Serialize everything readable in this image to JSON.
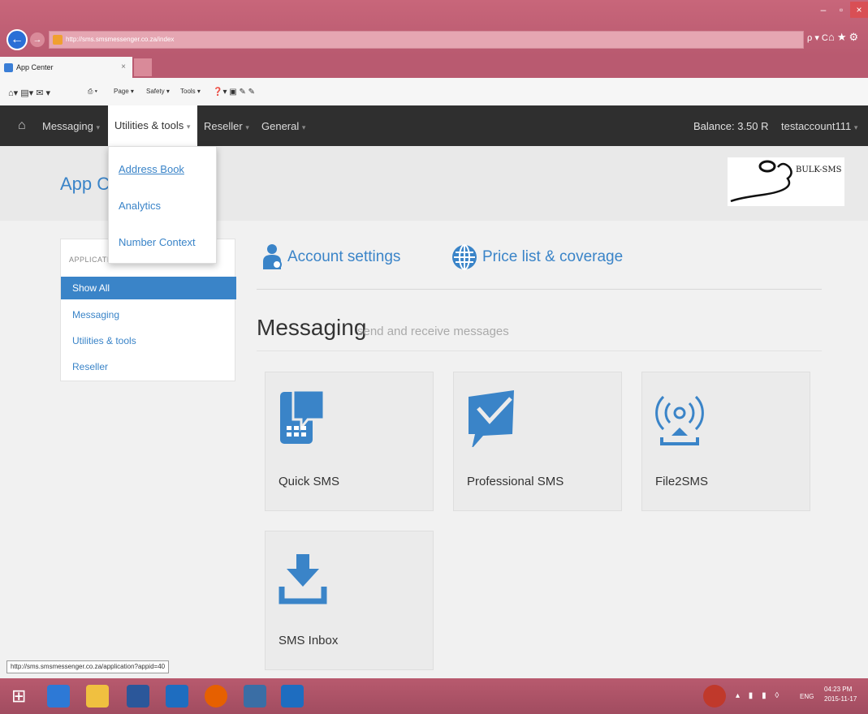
{
  "browser": {
    "url": "http://sms.smsmessenger.co.za/index",
    "tab_title": "App Center",
    "tab_close": "×",
    "addr_tools": "ρ ▾ C",
    "command_bar": {
      "page": "Page ▾",
      "safety": "Safety ▾",
      "tools": "Tools ▾"
    },
    "status_url": "http://sms.smsmessenger.co.za/application?appid=40"
  },
  "navbar": {
    "items": [
      {
        "label": "Messaging"
      },
      {
        "label": "Utilities & tools"
      },
      {
        "label": "Reseller"
      },
      {
        "label": "General"
      }
    ],
    "balance": "Balance: 3.50 R",
    "user": "testaccount111"
  },
  "dropdown": {
    "items": [
      "Address Book",
      "Analytics",
      "Number Context"
    ]
  },
  "header": {
    "title": "App Ce",
    "logo_text": "BULK-SMS"
  },
  "sidebar": {
    "heading": "APPLICATIC",
    "items": [
      "Show All",
      "Messaging",
      "Utilities & tools",
      "Reseller"
    ]
  },
  "main": {
    "links": [
      "Account settings",
      "Price list & coverage"
    ],
    "section_title": "Messaging",
    "section_subtitle": "send and receive messages",
    "cards": [
      "Quick SMS",
      "Professional SMS",
      "File2SMS",
      "SMS Inbox"
    ]
  },
  "taskbar": {
    "lang": "ENG",
    "time": "04:23 PM",
    "date": "2015-11-17"
  },
  "colors": {
    "accent": "#3a84c8",
    "navbar": "#2f2f2f",
    "chrome": "#b95a70"
  }
}
